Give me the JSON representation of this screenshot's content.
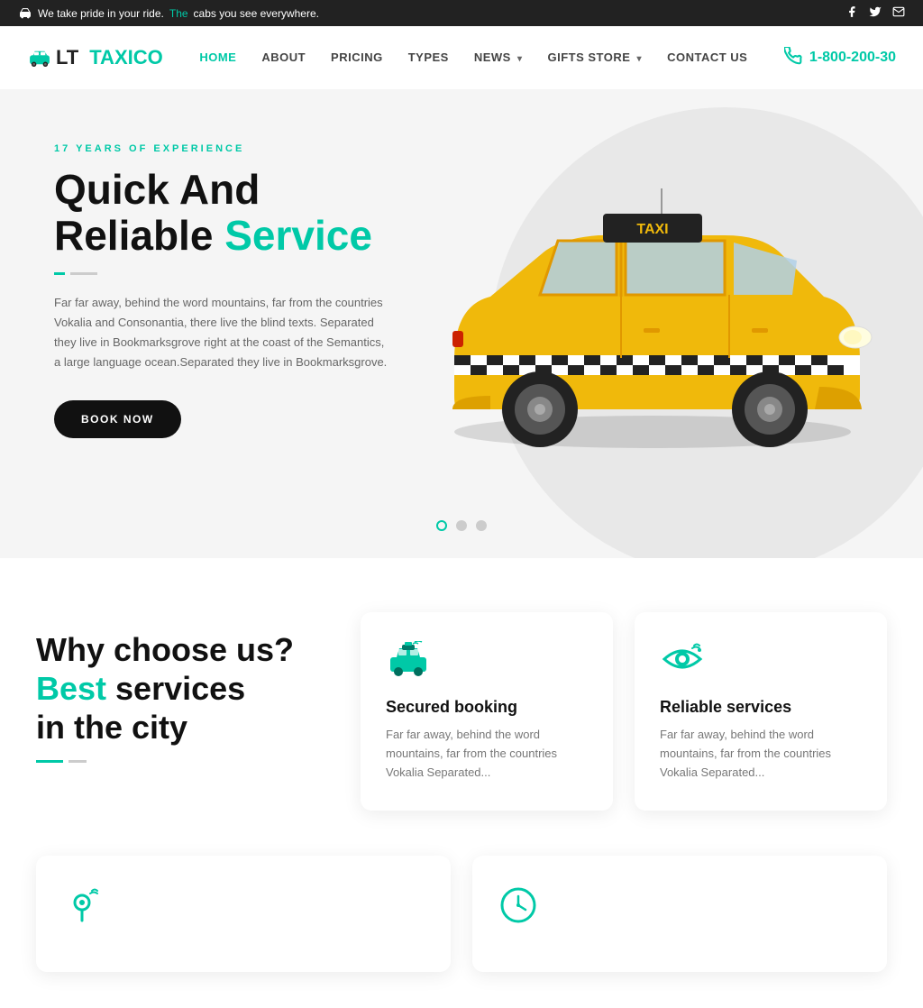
{
  "topbar": {
    "message_start": "We take pride in your ride. ",
    "message_highlight": "The",
    "message_end": " cabs you see everywhere.",
    "social": [
      "facebook",
      "twitter",
      "email"
    ]
  },
  "header": {
    "logo_lt": "LT",
    "logo_taxico": "TAXICO",
    "nav": [
      {
        "label": "HOME",
        "active": true,
        "has_dropdown": false
      },
      {
        "label": "ABOUT",
        "active": false,
        "has_dropdown": false
      },
      {
        "label": "PRICING",
        "active": false,
        "has_dropdown": false
      },
      {
        "label": "TYPES",
        "active": false,
        "has_dropdown": false
      },
      {
        "label": "NEWS",
        "active": false,
        "has_dropdown": true
      },
      {
        "label": "GIFTS STORE",
        "active": false,
        "has_dropdown": true
      },
      {
        "label": "CONTACT US",
        "active": false,
        "has_dropdown": false
      }
    ],
    "phone": "1-800-200-30"
  },
  "hero": {
    "eyebrow": "17 YEARS OF EXPERIENCE",
    "title_line1": "Quick And",
    "title_line2_normal": "Reliable",
    "title_line2_highlight": "Service",
    "body_text": "Far far away, behind the word mountains, far from the countries Vokalia and Consonantia, there live the blind texts. Separated they live in Bookmarksgrove right at the coast of the Semantics, a large language ocean.Separated they live in Bookmarksgrove.",
    "book_button": "BOOK NOW",
    "dots": [
      {
        "active": true
      },
      {
        "active": false
      },
      {
        "active": false
      }
    ]
  },
  "features_section": {
    "left_title_line1": "Why choose us?",
    "left_title_best": "Best",
    "left_title_line2": " services",
    "left_title_line3": "in the city"
  },
  "feature_cards": [
    {
      "icon": "taxi",
      "title": "Secured booking",
      "text": "Far far away, behind the word mountains, far from the countries Vokalia Separated..."
    },
    {
      "icon": "eye",
      "title": "Reliable services",
      "text": "Far far away, behind the word mountains, far from the countries Vokalia Separated..."
    }
  ],
  "bottom_partial_cards": [
    {
      "icon": "map",
      "title": "",
      "text": ""
    },
    {
      "icon": "clock",
      "title": "",
      "text": ""
    }
  ]
}
